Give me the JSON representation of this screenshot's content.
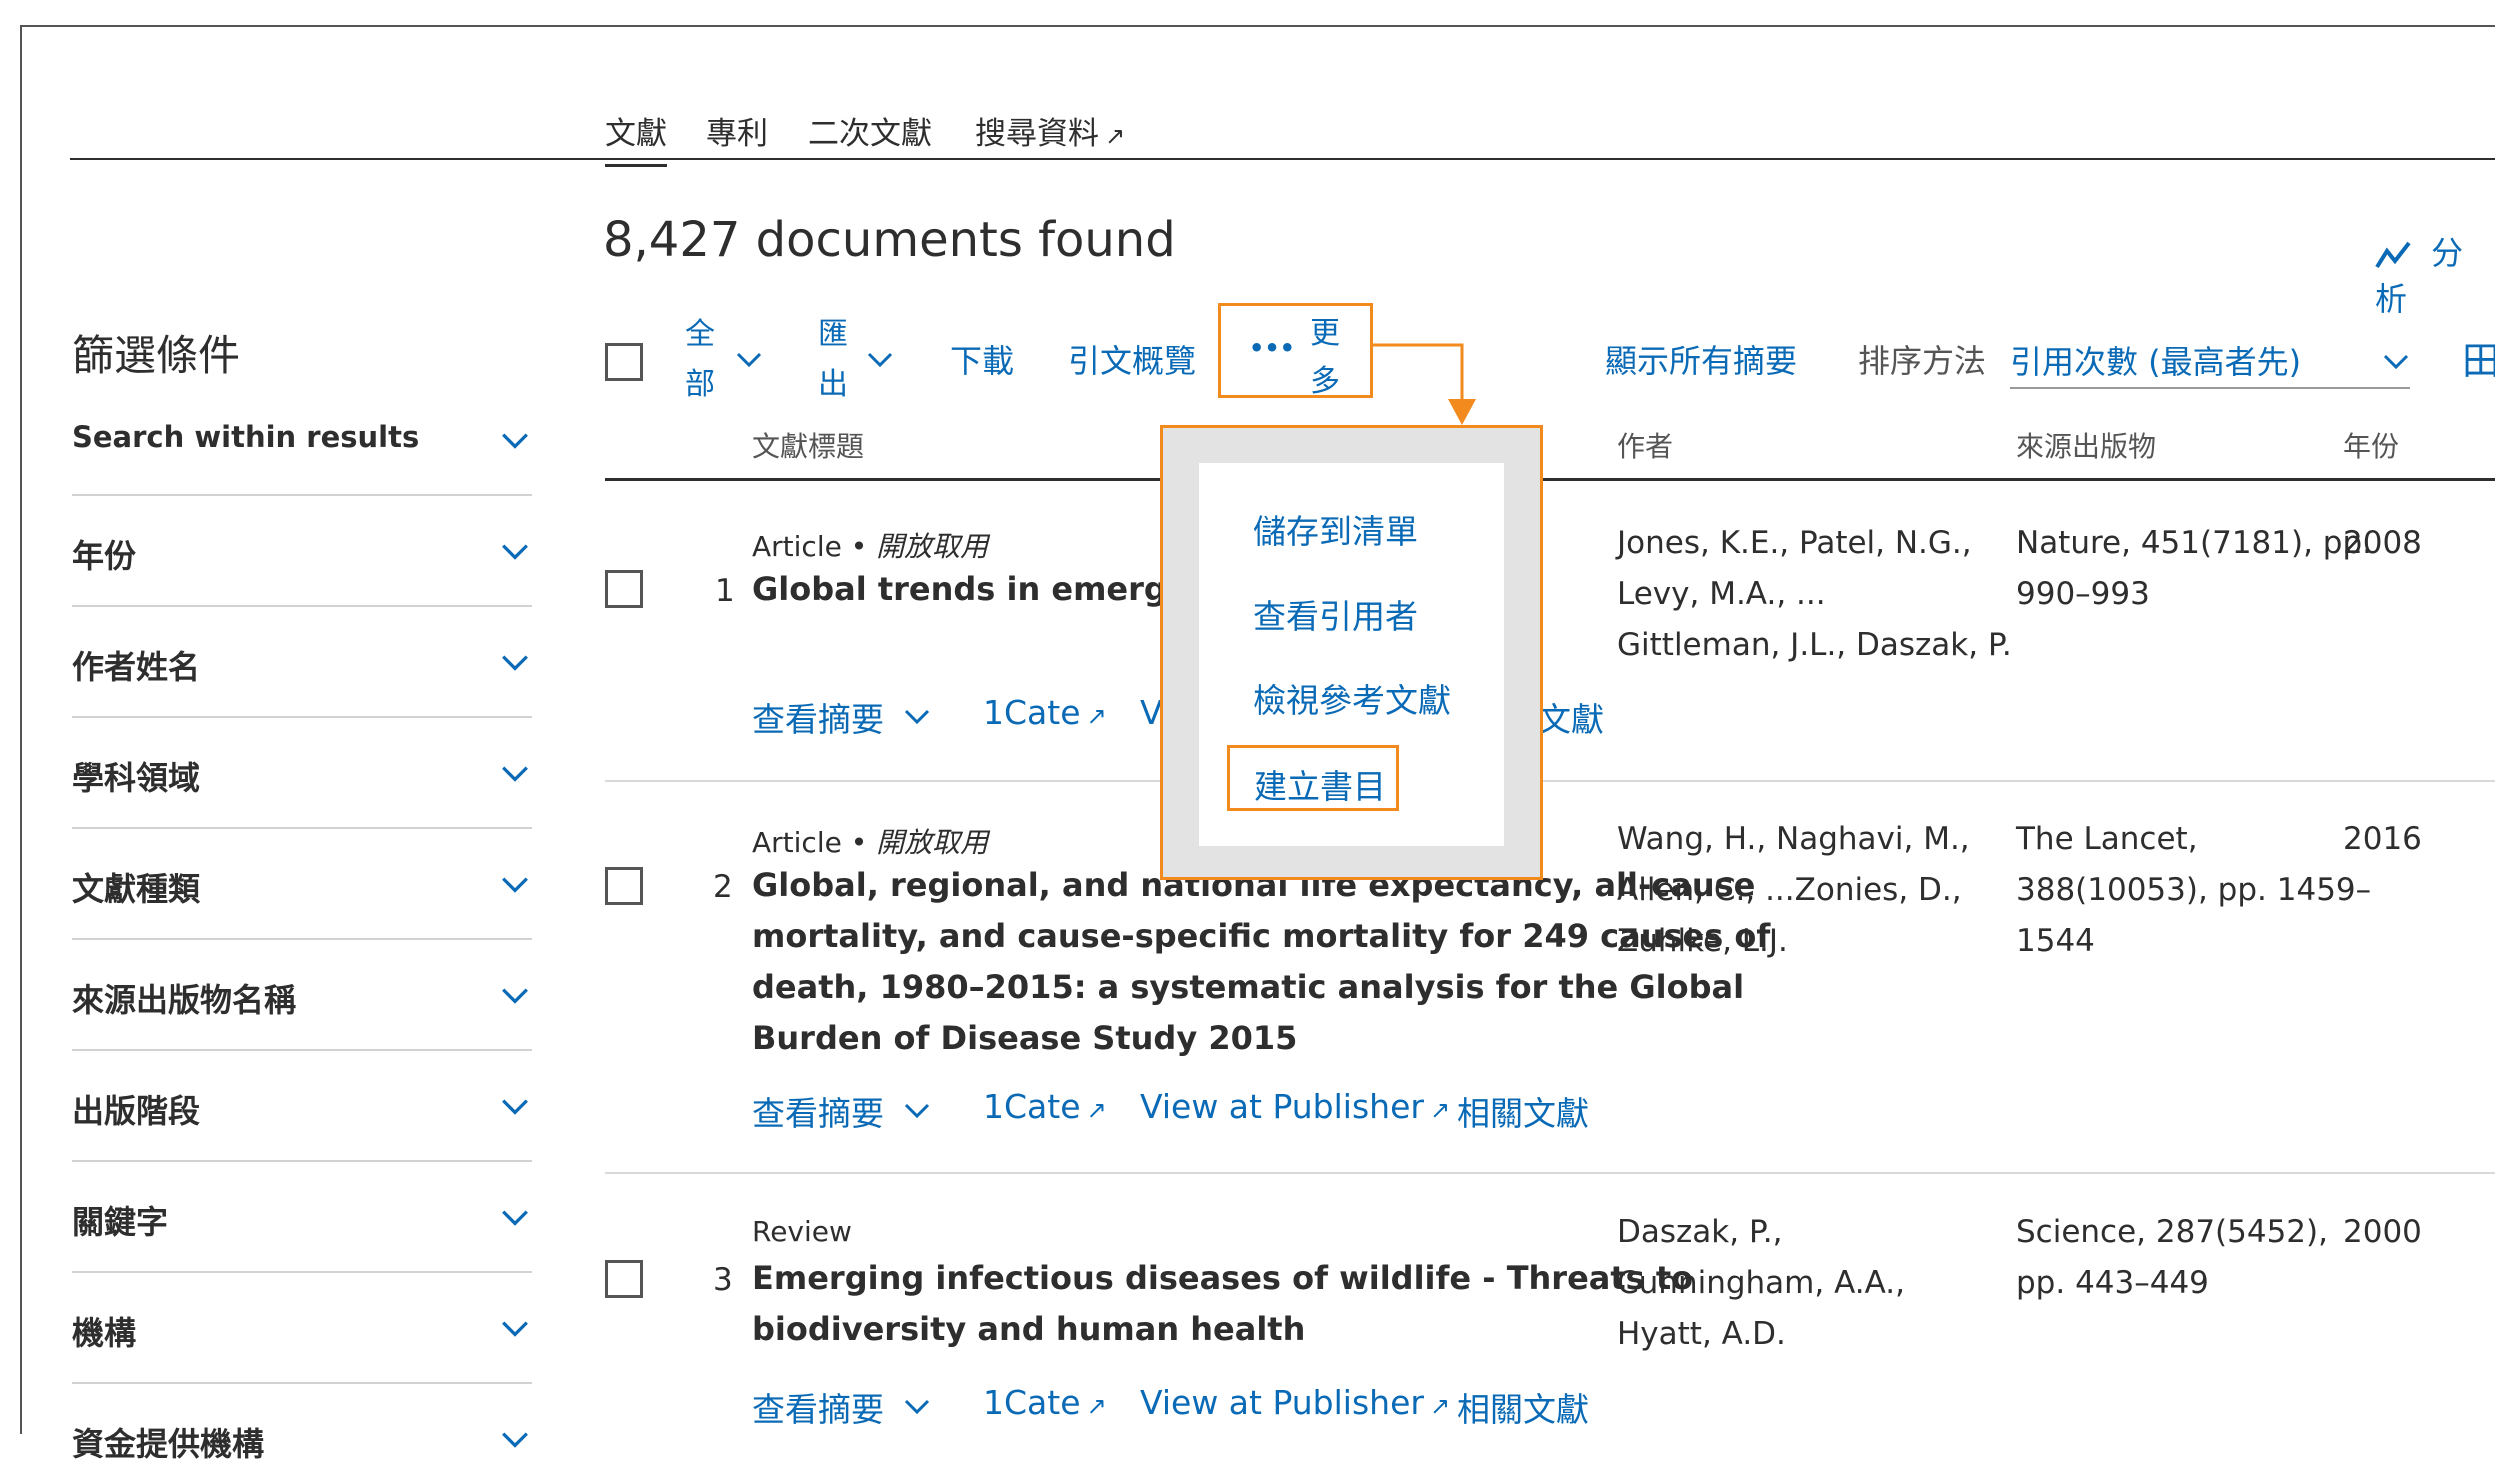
{
  "tabs": [
    "文獻",
    "專利",
    "二次文獻",
    "搜尋資料"
  ],
  "results_count": "8,427 documents found",
  "analyze_label": "分析",
  "sidebar": {
    "title": "篩選條件",
    "filters": [
      "Search within results",
      "年份",
      "作者姓名",
      "學科領域",
      "文獻種類",
      "來源出版物名稱",
      "出版階段",
      "關鍵字",
      "機構",
      "資金提供機構"
    ]
  },
  "toolbar": {
    "all_label": [
      "全",
      "部"
    ],
    "export_label": [
      "匯",
      "出"
    ],
    "download": "下載",
    "citation_overview": "引文概覽",
    "more_dots": "•••",
    "more_label": [
      "更",
      "多"
    ],
    "show_all_abstracts": "顯示所有摘要",
    "sort_label": "排序方法",
    "sort_value": "引用次數 (最高者先)",
    "grid_icon_glyph": "田"
  },
  "columns": [
    "文獻標題",
    "作者",
    "來源出版物",
    "年份"
  ],
  "more_menu": {
    "items": [
      "儲存到清單",
      "查看引用者",
      "檢視參考文獻",
      "建立書目"
    ]
  },
  "results": [
    {
      "num": "1",
      "type": "Article",
      "open_access": "開放取用",
      "title_visible": "Global trends in emerging infec",
      "authors": [
        "Jones, K.E., Patel, N.G.,",
        "Levy, M.A., ...",
        "Gittleman, J.L., Daszak, P."
      ],
      "source": [
        "Nature, 451(7181), pp.",
        "990–993"
      ],
      "year": "2008",
      "links": [
        "查看摘要",
        "1Cate",
        "View",
        "關文獻"
      ]
    },
    {
      "num": "2",
      "type": "Article",
      "open_access": "開放取用",
      "title": [
        "Global, regional, and national life expectancy, all-cause",
        "mortality, and cause-specific mortality for 249 causes of",
        "death, 1980–2015: a systematic analysis for the Global",
        "Burden of Disease Study 2015"
      ],
      "authors": [
        "Wang, H., Naghavi, M.,",
        "Allen, C., ...Zonies, D.,",
        "Zuhlke, L.J."
      ],
      "source": [
        "The Lancet,",
        "388(10053), pp. 1459–",
        "1544"
      ],
      "year": "2016",
      "links": [
        "查看摘要",
        "1Cate",
        "View at Publisher",
        "相關文獻"
      ]
    },
    {
      "num": "3",
      "type": "Review",
      "title": [
        "Emerging infectious diseases of wildlife - Threats to",
        "biodiversity and human health"
      ],
      "authors": [
        "Daszak, P.,",
        "Cunningham, A.A.,",
        "Hyatt, A.D."
      ],
      "source": [
        "Science, 287(5452),",
        "pp. 443–449"
      ],
      "year": "2000",
      "links": [
        "查看摘要",
        "1Cate",
        "View at Publisher",
        "相關文獻"
      ]
    }
  ],
  "colors": {
    "accent": "#0a6ab6",
    "highlight": "#f28a1e",
    "menu_backdrop": "#e3e3e3"
  }
}
